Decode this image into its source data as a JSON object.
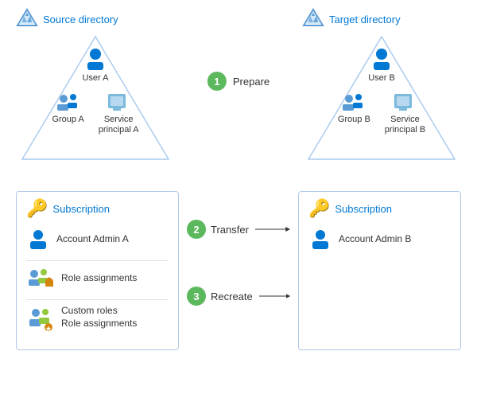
{
  "source_dir": {
    "label": "Source directory",
    "user_label": "User A",
    "group_label": "Group A",
    "service_label": "Service\nprincipal A"
  },
  "target_dir": {
    "label": "Target directory",
    "user_label": "User B",
    "group_label": "Group B",
    "service_label": "Service\nprincipal B"
  },
  "steps": {
    "prepare": "Prepare",
    "transfer": "Transfer",
    "recreate": "Recreate",
    "step1": "1",
    "step2": "2",
    "step3": "3"
  },
  "source_sub": {
    "label": "Subscription",
    "account_admin": "Account Admin A",
    "role_assignments": "Role assignments",
    "custom_roles": "Custom roles",
    "role_assignments2": "Role assignments"
  },
  "target_sub": {
    "label": "Subscription",
    "account_admin": "Account Admin B"
  }
}
